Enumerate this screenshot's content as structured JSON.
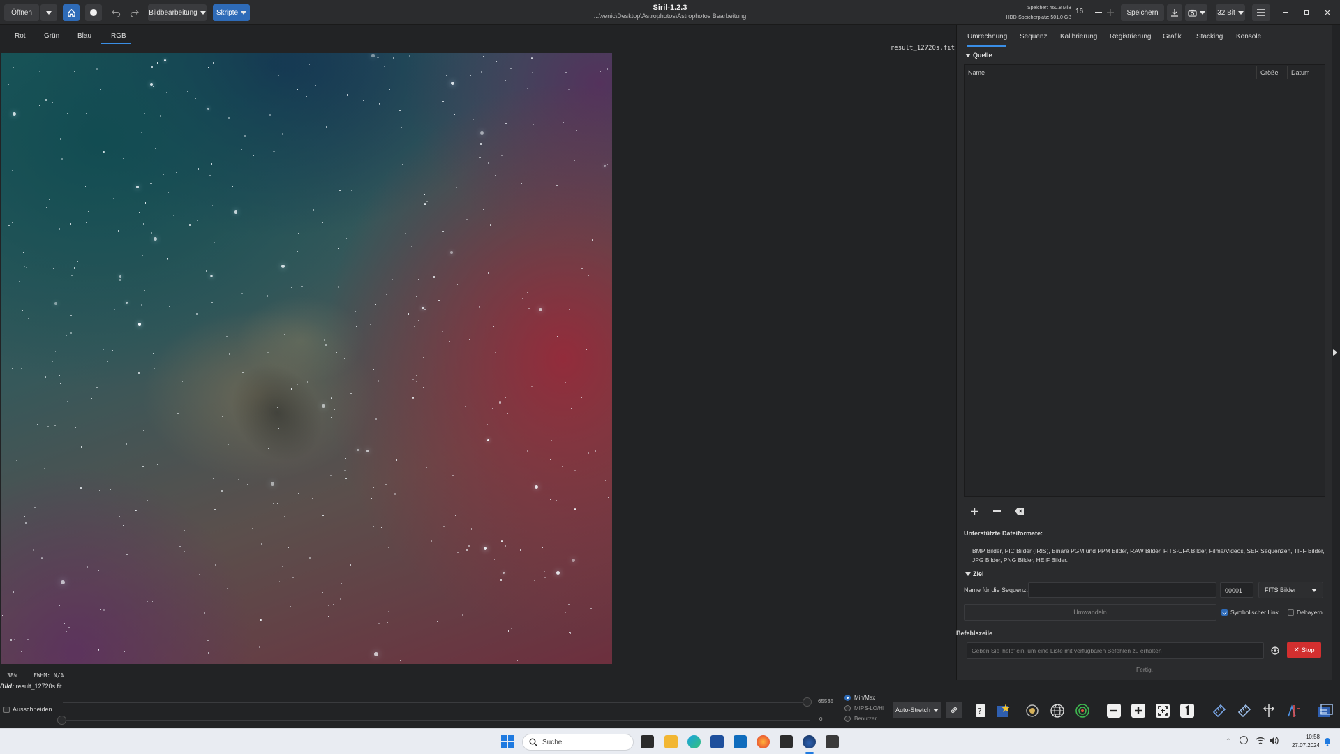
{
  "header": {
    "open_label": "Öffnen",
    "image_processing_label": "Bildbearbeitung",
    "scripts_label": "Skripte",
    "app_title": "Siril-1.2.3",
    "working_dir": "...\\venic\\Desktop\\Astrophotos\\Astrophotos Bearbeitung",
    "memory": "Speicher: 460.8 MiB",
    "disk": "HDD-Speicherplatz: 501.0 GB",
    "threads": "16",
    "save_label": "Speichern",
    "bitdepth_label": "32 Bit"
  },
  "channels": {
    "red": "Rot",
    "green": "Grün",
    "blue": "Blau",
    "rgb": "RGB",
    "active": "RGB"
  },
  "image": {
    "filename": "result_12720s.fit"
  },
  "status": {
    "zoom": "38%",
    "fwhm": "FWHM: N/A",
    "bild_label": "Bild:",
    "bild_value": "result_12720s.fit"
  },
  "bottom": {
    "crop_label": "Ausschneiden",
    "high_value": "65535",
    "low_value": "0",
    "modes": [
      "Min/Max",
      "MIPS-LO/HI",
      "Benutzer"
    ],
    "selected_mode": "Min/Max",
    "stretch_label": "Auto-Stretch"
  },
  "right_panel": {
    "tabs": [
      "Umrechnung",
      "Sequenz",
      "Kalibrierung",
      "Registrierung",
      "Grafik",
      "Stacking",
      "Konsole"
    ],
    "active_tab": "Umrechnung",
    "source_title": "Quelle",
    "columns": [
      "Name",
      "Größe",
      "Datum"
    ],
    "formats_title": "Unterstützte Dateiformate:",
    "formats_line1": "BMP Bilder, PIC Bilder (IRIS), Binäre PGM und PPM Bilder, RAW Bilder, FITS-CFA Bilder, Filme/Videos, SER Sequenzen, TIFF Bilder,",
    "formats_line2": "JPG Bilder, PNG Bilder, HEIF Bilder.",
    "target_title": "Ziel",
    "seq_name_label": "Name für die Sequenz:",
    "seq_name_value": "",
    "start_index": "00001",
    "output_format": "FITS Bilder",
    "convert_label": "Umwandeln",
    "symlink_label": "Symbolischer Link",
    "symlink_checked": true,
    "debayer_label": "Debayern",
    "debayer_checked": false,
    "cmdline_title": "Befehlszeile",
    "cmd_placeholder": "Geben Sie 'help' ein, um eine Liste mit verfügbaren Befehlen zu erhalten",
    "stop_label": "Stop",
    "status": "Fertig."
  },
  "taskbar": {
    "search_label": "Suche",
    "time": "10:58",
    "date": "27.07.2024"
  },
  "colors": {
    "accent": "#2e6bb8",
    "stop": "#d32f2f",
    "bg": "#222325"
  }
}
